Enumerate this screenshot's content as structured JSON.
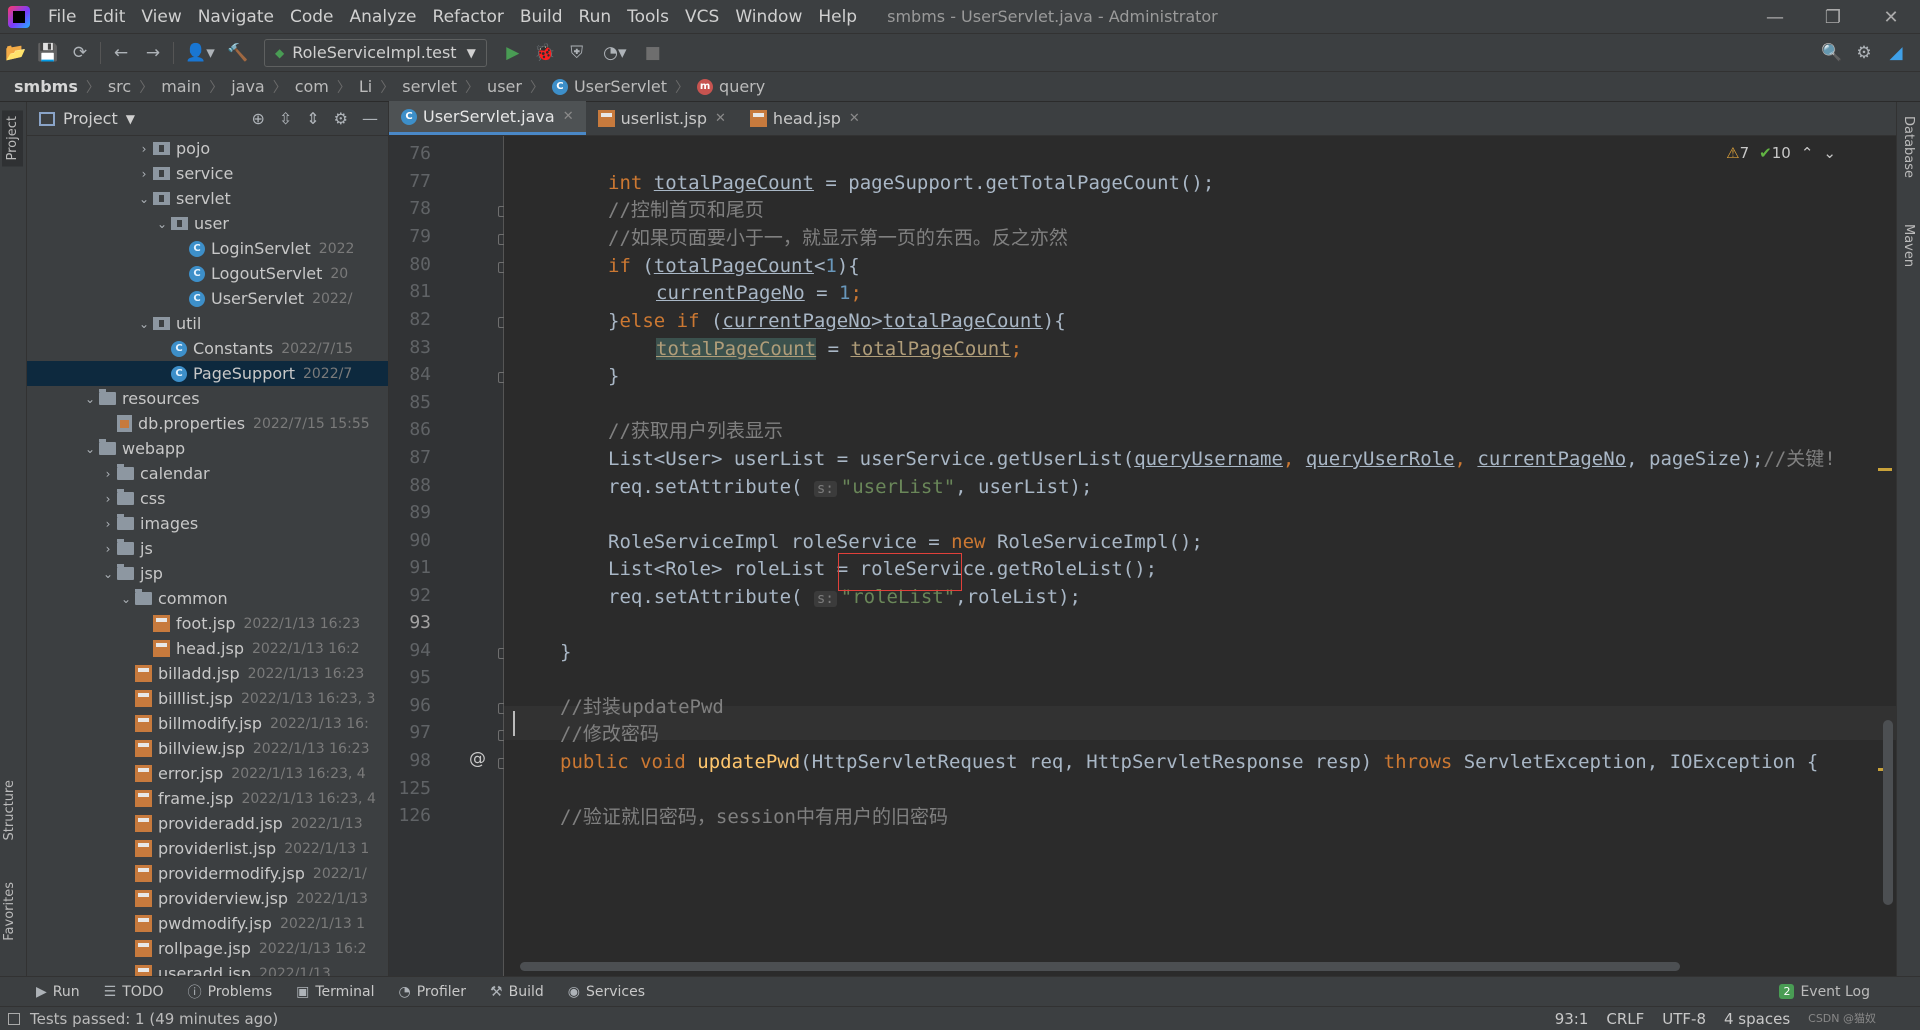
{
  "window": {
    "title": "smbms - UserServlet.java - Administrator",
    "menu": [
      "File",
      "Edit",
      "View",
      "Navigate",
      "Code",
      "Analyze",
      "Refactor",
      "Build",
      "Run",
      "Tools",
      "VCS",
      "Window",
      "Help"
    ]
  },
  "toolbar": {
    "run_config": "RoleServiceImpl.test"
  },
  "breadcrumb": {
    "items": [
      "smbms",
      "src",
      "main",
      "java",
      "com",
      "Li",
      "servlet",
      "user"
    ],
    "class_name": "UserServlet",
    "method_name": "query"
  },
  "project_panel": {
    "title": "Project",
    "tree": [
      {
        "name": "pojo",
        "kind": "pkg",
        "arrow": "›",
        "meta": ""
      },
      {
        "name": "service",
        "kind": "pkg",
        "arrow": "›",
        "meta": ""
      },
      {
        "name": "servlet",
        "kind": "pkg",
        "arrow": "⌄",
        "meta": ""
      },
      {
        "name": "user",
        "kind": "pkg",
        "arrow": "⌄",
        "meta": ""
      },
      {
        "name": "LoginServlet",
        "kind": "class",
        "arrow": "",
        "meta": "2022"
      },
      {
        "name": "LogoutServlet",
        "kind": "class",
        "arrow": "",
        "meta": "20"
      },
      {
        "name": "UserServlet",
        "kind": "class",
        "arrow": "",
        "meta": "2022/"
      },
      {
        "name": "util",
        "kind": "pkg",
        "arrow": "⌄",
        "meta": ""
      },
      {
        "name": "Constants",
        "kind": "class",
        "arrow": "",
        "meta": "2022/7/15"
      },
      {
        "name": "PageSupport",
        "kind": "class",
        "arrow": "",
        "meta": "2022/7"
      },
      {
        "name": "resources",
        "kind": "folder",
        "arrow": "⌄",
        "meta": ""
      },
      {
        "name": "db.properties",
        "kind": "props",
        "arrow": "",
        "meta": "2022/7/15 15:55"
      },
      {
        "name": "webapp",
        "kind": "folder",
        "arrow": "⌄",
        "meta": ""
      },
      {
        "name": "calendar",
        "kind": "folder",
        "arrow": "›",
        "meta": ""
      },
      {
        "name": "css",
        "kind": "folder",
        "arrow": "›",
        "meta": ""
      },
      {
        "name": "images",
        "kind": "folder",
        "arrow": "›",
        "meta": ""
      },
      {
        "name": "js",
        "kind": "folder",
        "arrow": "›",
        "meta": ""
      },
      {
        "name": "jsp",
        "kind": "folder",
        "arrow": "⌄",
        "meta": ""
      },
      {
        "name": "common",
        "kind": "folder",
        "arrow": "⌄",
        "meta": ""
      },
      {
        "name": "foot.jsp",
        "kind": "jsp",
        "arrow": "",
        "meta": "2022/1/13 16:23"
      },
      {
        "name": "head.jsp",
        "kind": "jsp",
        "arrow": "",
        "meta": "2022/1/13 16:2"
      },
      {
        "name": "billadd.jsp",
        "kind": "jsp",
        "arrow": "",
        "meta": "2022/1/13 16:23"
      },
      {
        "name": "billlist.jsp",
        "kind": "jsp",
        "arrow": "",
        "meta": "2022/1/13 16:23, 3"
      },
      {
        "name": "billmodify.jsp",
        "kind": "jsp",
        "arrow": "",
        "meta": "2022/1/13 16:"
      },
      {
        "name": "billview.jsp",
        "kind": "jsp",
        "arrow": "",
        "meta": "2022/1/13 16:23"
      },
      {
        "name": "error.jsp",
        "kind": "jsp",
        "arrow": "",
        "meta": "2022/1/13 16:23, 4"
      },
      {
        "name": "frame.jsp",
        "kind": "jsp",
        "arrow": "",
        "meta": "2022/1/13 16:23, 4"
      },
      {
        "name": "provideradd.jsp",
        "kind": "jsp",
        "arrow": "",
        "meta": "2022/1/13"
      },
      {
        "name": "providerlist.jsp",
        "kind": "jsp",
        "arrow": "",
        "meta": "2022/1/13 1"
      },
      {
        "name": "providermodify.jsp",
        "kind": "jsp",
        "arrow": "",
        "meta": "2022/1/"
      },
      {
        "name": "providerview.jsp",
        "kind": "jsp",
        "arrow": "",
        "meta": "2022/1/13"
      },
      {
        "name": "pwdmodify.jsp",
        "kind": "jsp",
        "arrow": "",
        "meta": "2022/1/13 1"
      },
      {
        "name": "rollpage.jsp",
        "kind": "jsp",
        "arrow": "",
        "meta": "2022/1/13 16:2"
      },
      {
        "name": "useradd.jsp",
        "kind": "jsp",
        "arrow": "",
        "meta": "2022/1/13"
      }
    ]
  },
  "editor": {
    "tabs": [
      "UserServlet.java",
      "userlist.jsp",
      "head.jsp"
    ],
    "inspections": {
      "warnings": "7",
      "weak_warnings": "10"
    },
    "line_numbers": [
      "76",
      "77",
      "78",
      "79",
      "80",
      "81",
      "82",
      "83",
      "84",
      "85",
      "86",
      "87",
      "88",
      "89",
      "90",
      "91",
      "92",
      "93",
      "94",
      "95",
      "96",
      "97",
      "98",
      "125",
      "126"
    ],
    "current_line": "93",
    "code": {
      "l77": {
        "kw": "int",
        "var": "totalPageCount",
        "rest": " = pageSupport.getTotalPageCount();"
      },
      "l78": "//控制首页和尾页",
      "l79": "//如果页面要小于一，就显示第一页的东西。反之亦然",
      "l80": {
        "kw": "if",
        "open": " (",
        "var": "totalPageCount",
        "rest": "<",
        "num": "1",
        "close": "){"
      },
      "l81": {
        "var": "currentPageNo",
        "rest": " = ",
        "num": "1",
        "end": ";"
      },
      "l82": {
        "pre": "}",
        "kw": "else if",
        "open": " (",
        "var1": "currentPageNo",
        "op": ">",
        "var2": "totalPageCount",
        "close": "){"
      },
      "l83": {
        "var1": "totalPageCount",
        "op": " = ",
        "var2": "totalPageCount",
        "end": ";"
      },
      "l84": "}",
      "l86": "//获取用户列表显示",
      "l87": {
        "pre": "List<User> userList = userService.getUserList(",
        "a1": "queryUsername",
        "a2": "queryUserRole",
        "a3": "currentPageNo",
        "post": ", pageSize);",
        "cm": "//关键!"
      },
      "l88": {
        "pre": "req.setAttribute(",
        "hint": "s:",
        "str": "\"userList\"",
        "post": ", userList);"
      },
      "l90": {
        "pre": "RoleServiceImpl roleService = ",
        "kw": "new",
        "post": " RoleServiceImpl();"
      },
      "l91": "List<Role> roleList = roleService.getRoleList();",
      "l92": {
        "pre": "req.setAttribute(",
        "hint": "s:",
        "str": "\"roleList\"",
        "post": ",roleList);"
      },
      "l94": "}",
      "l96": "//封装updatePwd",
      "l97": "//修改密码",
      "l98": {
        "kw1": "public void",
        "fn": "updatePwd",
        "mid": "(HttpServletRequest req, HttpServletResponse resp) ",
        "kw2": "throws",
        "post": " ServletException, IOException {"
      },
      "l126": "//验证就旧密码，session中有用户的旧密码"
    }
  },
  "bottom_tabs": [
    "Run",
    "TODO",
    "Problems",
    "Terminal",
    "Profiler",
    "Build",
    "Services"
  ],
  "event_log": {
    "label": "Event Log",
    "count": "2"
  },
  "status": {
    "message": "Tests passed: 1 (49 minutes ago)",
    "position": "93:1",
    "line_sep": "CRLF",
    "encoding": "UTF-8",
    "indent": "4 spaces",
    "watermark": "CSDN @猫奴"
  },
  "side_tabs": {
    "left_top": "Project",
    "left_mid": "Structure",
    "left_bottom": "Favorites",
    "right_top": "Database",
    "right_mid": "Maven"
  }
}
